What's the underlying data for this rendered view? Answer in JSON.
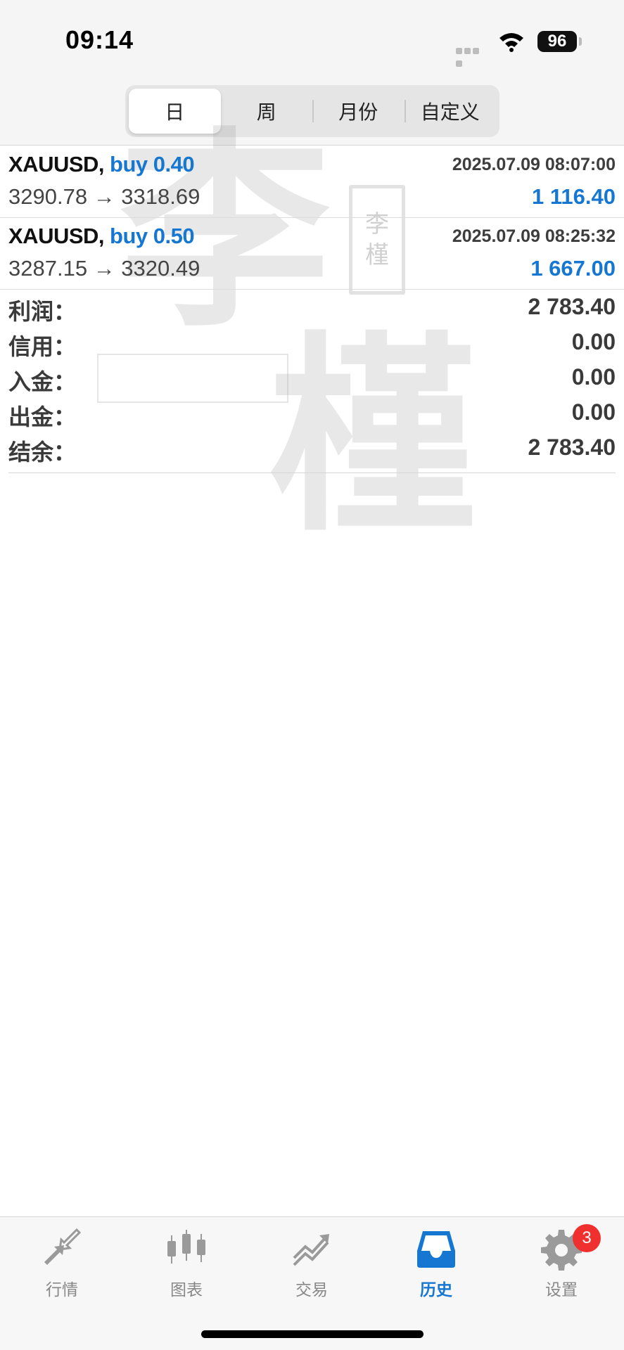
{
  "status": {
    "time": "09:14",
    "battery": "96"
  },
  "segments": [
    {
      "label": "日",
      "active": true
    },
    {
      "label": "周",
      "active": false
    },
    {
      "label": "月份",
      "active": false
    },
    {
      "label": "自定义",
      "active": false
    }
  ],
  "watermark": {
    "char1": "李",
    "char2": "槿",
    "seal_top": "李",
    "seal_bottom": "槿"
  },
  "deals": [
    {
      "symbol": "XAUUSD,",
      "type": "buy 0.40",
      "time": "2025.07.09 08:07:00",
      "prices": "3290.78 → 3318.69",
      "profit": "1 116.40"
    },
    {
      "symbol": "XAUUSD,",
      "type": "buy 0.50",
      "time": "2025.07.09 08:25:32",
      "prices": "3287.15 → 3320.49",
      "profit": "1 667.00"
    }
  ],
  "summary": [
    {
      "label": "利润：",
      "value": "2 783.40"
    },
    {
      "label": "信用：",
      "value": "0.00"
    },
    {
      "label": "入金：",
      "value": "0.00"
    },
    {
      "label": "出金：",
      "value": "0.00"
    },
    {
      "label": "结余：",
      "value": "2 783.40"
    }
  ],
  "tabs": [
    {
      "label": "行情",
      "icon": "quotes-arrows-icon",
      "active": false
    },
    {
      "label": "图表",
      "icon": "candlestick-chart-icon",
      "active": false
    },
    {
      "label": "交易",
      "icon": "trade-trend-icon",
      "active": false
    },
    {
      "label": "历史",
      "icon": "history-inbox-icon",
      "active": true
    },
    {
      "label": "设置",
      "icon": "settings-gear-icon",
      "active": false,
      "badge": "3"
    }
  ],
  "colors": {
    "accent": "#1677d2",
    "badge": "#f0302f",
    "inactive_icon": "#9a9a9a"
  }
}
